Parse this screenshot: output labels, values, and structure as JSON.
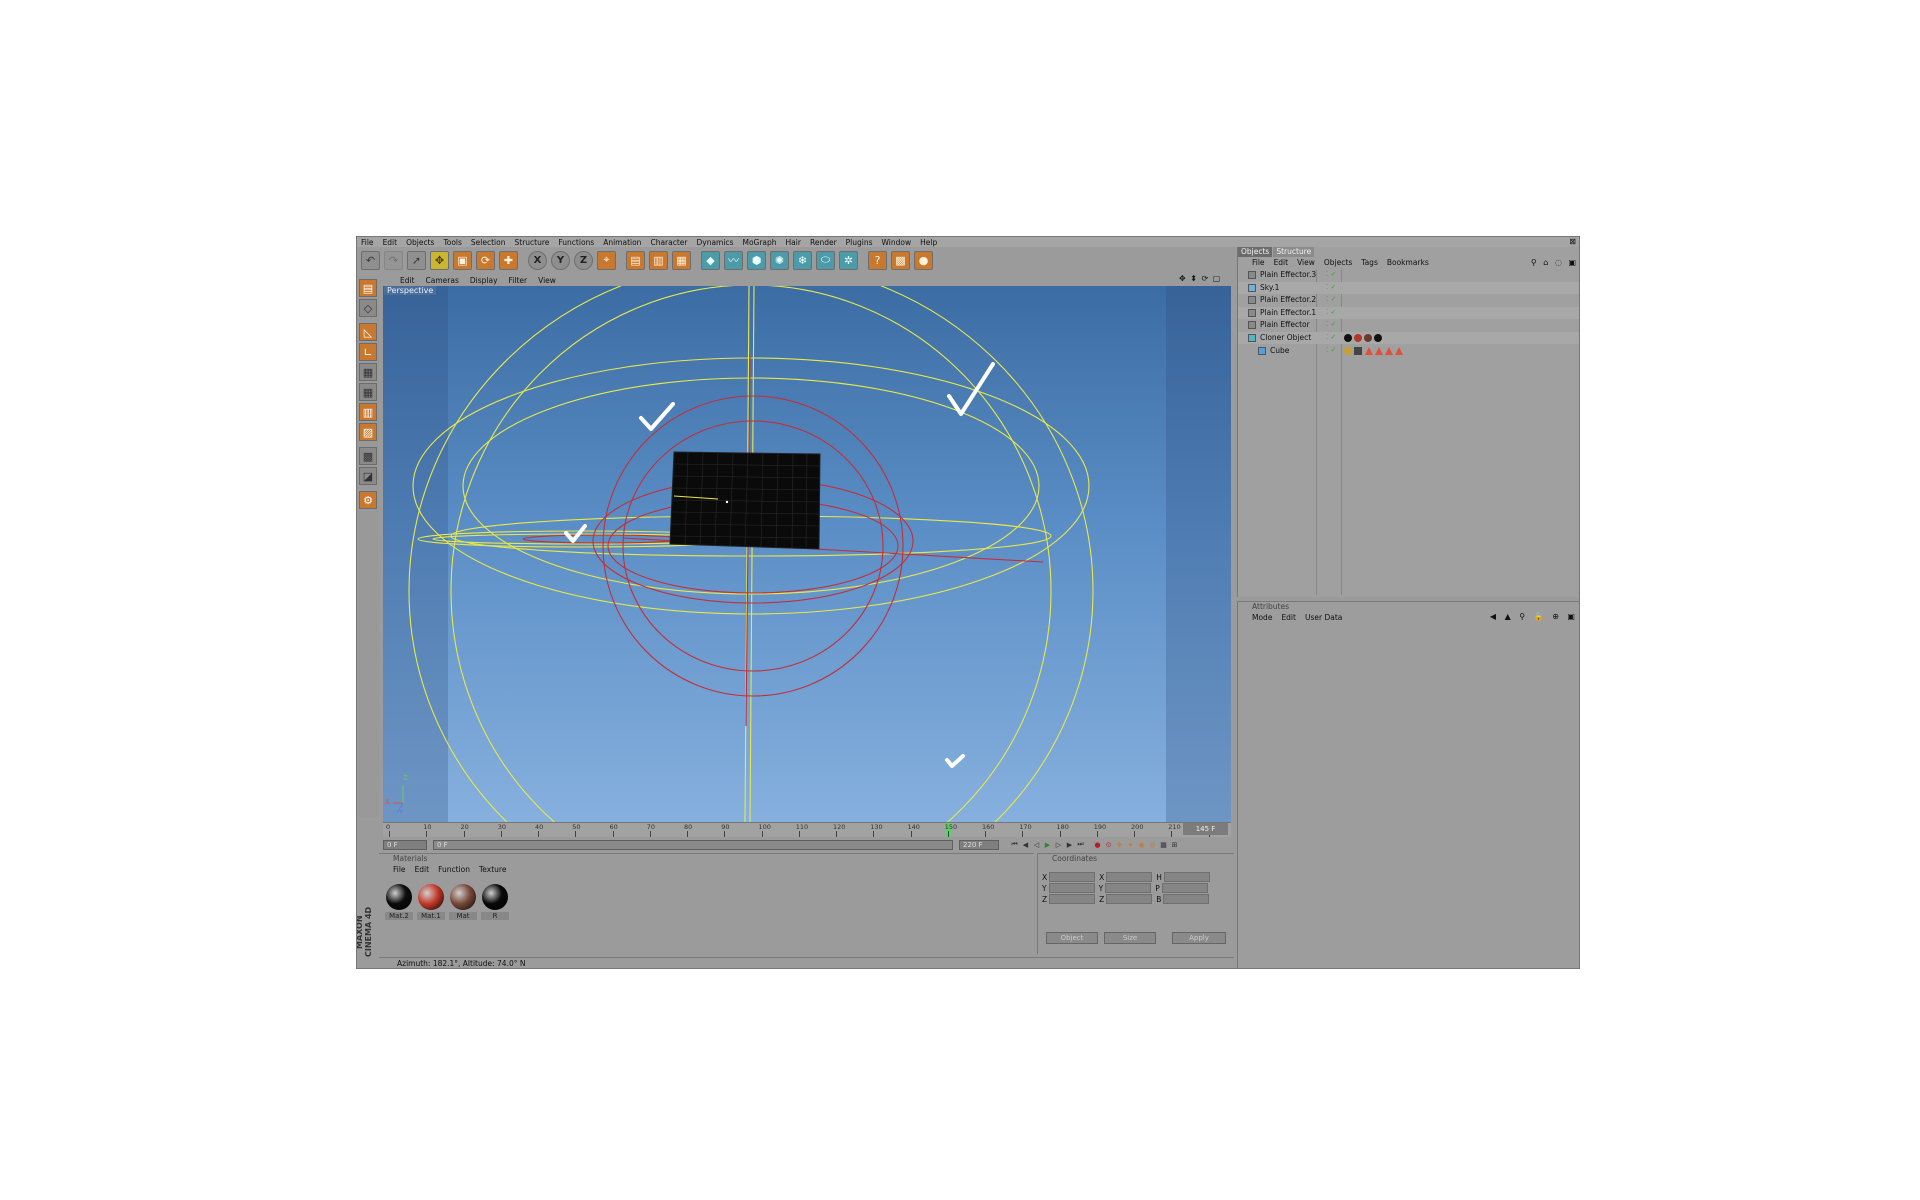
{
  "menubar": {
    "items": [
      "File",
      "Edit",
      "Objects",
      "Tools",
      "Selection",
      "Structure",
      "Functions",
      "Animation",
      "Character",
      "Dynamics",
      "MoGraph",
      "Hair",
      "Render",
      "Plugins",
      "Window",
      "Help"
    ]
  },
  "toolbar": {
    "buttons": [
      {
        "icon": "undo-icon"
      },
      {
        "icon": "redo-icon"
      },
      {
        "icon": "live-select-icon"
      },
      {
        "icon": "move-icon"
      },
      {
        "icon": "scale-icon"
      },
      {
        "icon": "rotate-icon"
      },
      {
        "icon": "last-tool-icon"
      },
      {
        "icon": "x-axis-icon",
        "label": "X"
      },
      {
        "icon": "y-axis-icon",
        "label": "Y"
      },
      {
        "icon": "z-axis-icon",
        "label": "Z"
      },
      {
        "icon": "coordinate-system-icon"
      },
      {
        "icon": "render-view-icon"
      },
      {
        "icon": "render-picture-viewer-icon"
      },
      {
        "icon": "render-settings-icon"
      },
      {
        "icon": "cube-object-icon"
      },
      {
        "icon": "spline-icon"
      },
      {
        "icon": "nurbs-icon"
      },
      {
        "icon": "array-icon"
      },
      {
        "icon": "deformer-icon"
      },
      {
        "icon": "scene-icon"
      },
      {
        "icon": "light-icon"
      },
      {
        "icon": "help-icon"
      },
      {
        "icon": "layer-icon"
      },
      {
        "icon": "sphere-icon"
      }
    ]
  },
  "viewport": {
    "menu": [
      "Edit",
      "Cameras",
      "Display",
      "Filter",
      "View"
    ],
    "label": "Perspective",
    "controls": "✥ ⬍ ⟳ ▢",
    "axis_labels": {
      "x": "X",
      "y": "Y",
      "z": "Z"
    }
  },
  "timeline": {
    "ticks": [
      "0",
      "10",
      "20",
      "30",
      "40",
      "50",
      "60",
      "70",
      "80",
      "90",
      "100",
      "110",
      "120",
      "130",
      "140",
      "150",
      "160",
      "170",
      "180",
      "190",
      "200",
      "210",
      "22"
    ],
    "current_frame_box": "145 F",
    "playhead_fraction": 0.67,
    "start_field": "0 F",
    "end_field": "220 F",
    "range_field": "0 F"
  },
  "materials": {
    "title": "Materials",
    "menu": [
      "File",
      "Edit",
      "Function",
      "Texture"
    ],
    "items": [
      {
        "label": "Mat.2",
        "color": "#0c0c0c"
      },
      {
        "label": "Mat.1",
        "color": "#c43a2a"
      },
      {
        "label": "Mat",
        "color": "#7a4a3a"
      },
      {
        "label": "R",
        "color": "#080808"
      }
    ]
  },
  "coordinates": {
    "title": "Coordinates",
    "rows": [
      {
        "a": "X",
        "b": "X",
        "c": "H"
      },
      {
        "a": "Y",
        "b": "Y",
        "c": "P"
      },
      {
        "a": "Z",
        "b": "Z",
        "c": "B"
      }
    ],
    "object_dropdown": "Object",
    "size_dropdown": "Size",
    "apply_label": "Apply"
  },
  "status": {
    "text": "Azimuth: 182.1°, Altitude: 74.0°  N"
  },
  "brand": {
    "line1": "MAXON",
    "line2": "CINEMA 4D"
  },
  "objects_manager": {
    "tabs": [
      "Objects",
      "Structure"
    ],
    "menu": [
      "File",
      "Edit",
      "View",
      "Objects",
      "Tags",
      "Bookmarks"
    ],
    "icons": "⚲ ⌂ ◌ ▣",
    "rows": [
      {
        "name": "Plain Effector.3",
        "indent": 0,
        "icon_color": "#8a8a8a"
      },
      {
        "name": "Sky.1",
        "indent": 0,
        "icon_color": "#6fb0e0"
      },
      {
        "name": "Plain Effector.2",
        "indent": 0,
        "icon_color": "#8a8a8a"
      },
      {
        "name": "Plain Effector.1",
        "indent": 0,
        "icon_color": "#8a8a8a"
      },
      {
        "name": "Plain Effector",
        "indent": 0,
        "icon_color": "#8a8a8a"
      },
      {
        "name": "Cloner Object",
        "indent": 0,
        "icon_color": "#4fb8c8"
      },
      {
        "name": "Cube",
        "indent": 1,
        "icon_color": "#4fa0e0"
      }
    ]
  },
  "attributes": {
    "title": "Attributes",
    "menu": [
      "Mode",
      "Edit",
      "User Data"
    ],
    "icons": "◀ ▲ ⚲ 🔒 ⊕ ▣"
  },
  "colors": {
    "app_bg": "#9b9b9b",
    "viewport_top": "#3c6ca4",
    "viewport_bottom": "#86b0de",
    "yellow_wire": "#e8e84a",
    "red_wire": "#c0303a",
    "accent_orange": "#c9782f"
  }
}
